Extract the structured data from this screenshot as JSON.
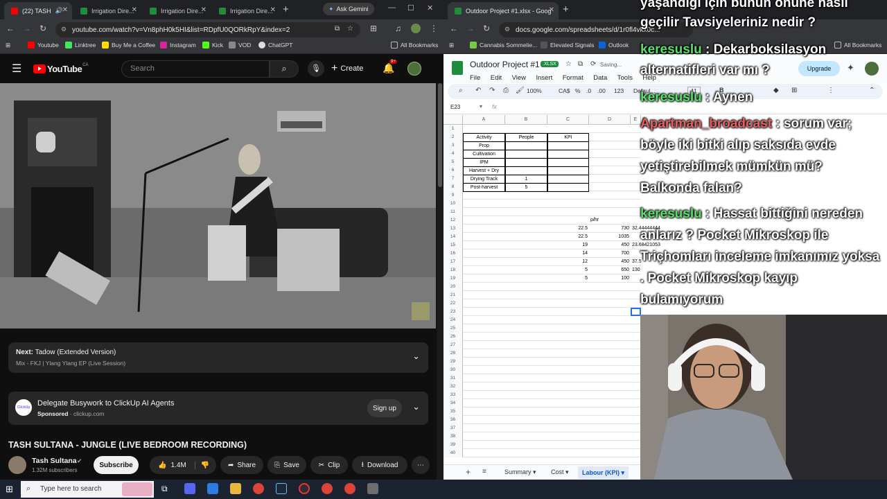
{
  "left_browser": {
    "tabs": [
      {
        "label": "(22) TASH",
        "active": true
      },
      {
        "label": "Irrigation Dire..."
      },
      {
        "label": "Irrigation Dire..."
      },
      {
        "label": "Irrigation Dire..."
      }
    ],
    "ask_gemini": "Ask Gemini",
    "url": "youtube.com/watch?v=Vn8phH0k5HI&list=RDpfU0QORkRpY&index=2",
    "bookmarks": [
      "Youtube",
      "Linktree",
      "Buy Me a Coffee",
      "Instagram",
      "Kick",
      "VOD",
      "ChatGPT"
    ],
    "all_bookmarks": "All Bookmarks"
  },
  "youtube": {
    "logo": "YouTube",
    "logo_region": "CA",
    "search_placeholder": "Search",
    "create": "Create",
    "notif_count": "9+",
    "next_label": "Next:",
    "next_title": "Tadow (Extended Version)",
    "next_sub": "Mix - FKJ  |  Ylang Ylang EP (Live Session)",
    "ad_title": "Delegate Busywork to ClickUp AI Agents",
    "ad_sponsored": "Sponsored",
    "ad_domain": "clickup.com",
    "ad_brand": "ClickUp",
    "ad_cta": "Sign up",
    "video_title": "TASH SULTANA - JUNGLE (LIVE BEDROOM RECORDING)",
    "channel": "Tash Sultana",
    "subs": "1.32M subscribers",
    "subscribe": "Subscribe",
    "likes": "1.4M",
    "share": "Share",
    "save": "Save",
    "clip": "Clip",
    "download": "Download"
  },
  "right_browser": {
    "tab": "Outdoor Project #1.xlsx - Goog",
    "url": "docs.google.com/spreadsheets/d/1r0fl4vkx0c...",
    "bookmarks": [
      "Cannabis Sommelie...",
      "Elevated Signals",
      "Outlook"
    ],
    "all_bookmarks": "All Bookmarks"
  },
  "sheets": {
    "title": "Outdoor Project #1",
    "badge": ".XLSX",
    "saving": "Saving...",
    "menu": [
      "File",
      "Edit",
      "View",
      "Insert",
      "Format",
      "Data",
      "Tools",
      "Help"
    ],
    "upgrade": "Upgrade",
    "zoom": "100%",
    "currency": "CA$",
    "font_size": "11",
    "font_name": "Defaul...",
    "name_box": "E23",
    "columns": [
      "A",
      "B",
      "C",
      "D",
      "E"
    ],
    "rows": 40,
    "table_headers": [
      "Activity",
      "People",
      "KPI"
    ],
    "table_rows": [
      [
        "Prop",
        "",
        ""
      ],
      [
        "Cultivation",
        "",
        ""
      ],
      [
        "IPM",
        "",
        ""
      ],
      [
        "Harvest + Dry",
        "",
        ""
      ],
      [
        "Drying Track",
        "1",
        ""
      ],
      [
        "Post-harvest",
        "5",
        ""
      ]
    ],
    "d12": "p/hr",
    "kpi_rows": [
      {
        "c": "22.5",
        "d": "730",
        "e": "32.44444444"
      },
      {
        "c": "22.5",
        "d": "1035",
        "e": ""
      },
      {
        "c": "19",
        "d": "450",
        "e": "23.68421053"
      },
      {
        "c": "14",
        "d": "700",
        "e": ""
      },
      {
        "c": "12",
        "d": "450",
        "e": "37.5"
      },
      {
        "c": "5",
        "d": "650",
        "e": "130"
      },
      {
        "c": "5",
        "d": "100",
        "e": ""
      }
    ],
    "sheet_tabs": [
      "Summary",
      "Cost",
      "Labour (KPI)"
    ]
  },
  "chat_overlay": {
    "line1": "yaşandığı için bunun önüne nasıl",
    "line2": "geçilir Tavsiyeleriniz nedir ?",
    "user1": "keresuslu",
    "msg1a": ": Dekarboksilasyon",
    "msg1b": "alternatifleri var mı ?",
    "user2": "keresuslu",
    "msg2": ": Aynen",
    "user3": "Apartman_broadcast",
    "msg3a": ": sorum var;",
    "msg3b": "böyle iki bitki alıp saksıda evde",
    "msg3c": "yetiştirebilmek mümkün mü?",
    "msg3d": "Balkonda falan?",
    "user4": "keresuslu",
    "msg4a": ": Hassat bittiğini nereden",
    "msg4b": "anlarız ? Pocket Mikroskop ile",
    "msg4c": "Triçhomları inceleme imkanımız yoksa",
    "msg4d": ". Pocket Mikroskop kayıp",
    "msg4e": "bulamıyorum"
  },
  "taskbar": {
    "search_placeholder": "Type here to search"
  }
}
